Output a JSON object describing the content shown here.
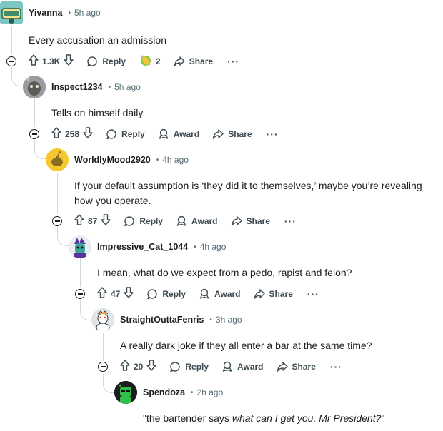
{
  "comments": [
    {
      "author": "Yivanna",
      "time": "5h ago",
      "text": "Every accusation an admission",
      "votes": "1.3K",
      "award_count": "2",
      "reply_label": "Reply",
      "share_label": "Share",
      "more_label": "···"
    },
    {
      "author": "Inspect1234",
      "time": "5h ago",
      "text": "Tells on himself daily.",
      "votes": "258",
      "reply_label": "Reply",
      "award_label": "Award",
      "share_label": "Share",
      "more_label": "···"
    },
    {
      "author": "WorldlyMood2920",
      "time": "4h ago",
      "text": "If your default assumption is ‘they did it to themselves,’ maybe you’re revealing how you operate.",
      "votes": "87",
      "reply_label": "Reply",
      "award_label": "Award",
      "share_label": "Share",
      "more_label": "···"
    },
    {
      "author": "Impressive_Cat_1044",
      "time": "4h ago",
      "text": "I mean, what do we expect from a pedo, rapist and felon?",
      "votes": "47",
      "reply_label": "Reply",
      "award_label": "Award",
      "share_label": "Share",
      "more_label": "···"
    },
    {
      "author": "StraightOuttaFenris",
      "time": "3h ago",
      "text": "A really dark joke if they all enter a bar at the same time?",
      "votes": "20",
      "reply_label": "Reply",
      "award_label": "Award",
      "share_label": "Share",
      "more_label": "···"
    },
    {
      "author": "Spendoza",
      "time": "2h ago",
      "text_prefix": "\"the bartender says ",
      "text_italic": "what can I get you, Mr President?",
      "text_suffix": "\""
    }
  ]
}
